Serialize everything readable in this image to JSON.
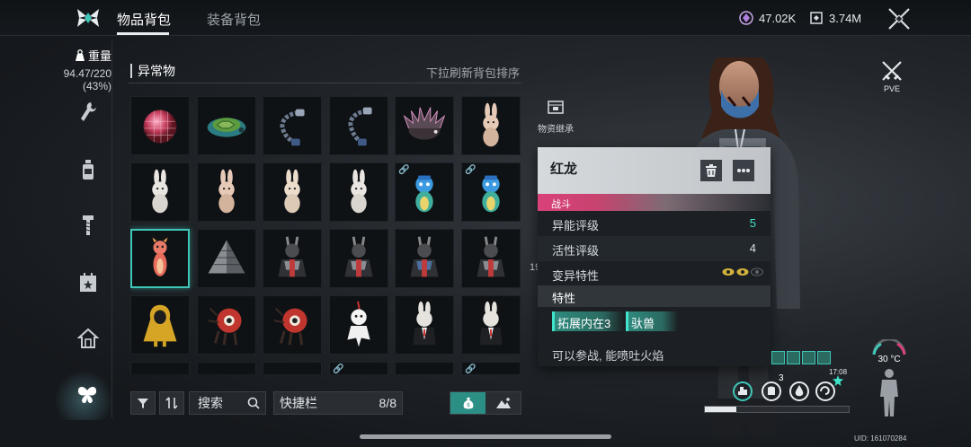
{
  "tabs": [
    {
      "label": "物品背包",
      "active": true
    },
    {
      "label": "装备背包",
      "active": false
    }
  ],
  "currency": [
    {
      "icon": "crystal-icon",
      "value": "47.02K"
    },
    {
      "icon": "supply-icon",
      "value": "3.74M"
    }
  ],
  "weight": {
    "title": "重量",
    "value": "94.47/220",
    "percent": "(43%)"
  },
  "sidebar": [
    "wrench-icon",
    "bottle-icon",
    "bolt-icon",
    "calendar-icon",
    "house-icon",
    "butterfly-icon"
  ],
  "section": {
    "title": "异常物",
    "hint": "下拉刷新背包排序"
  },
  "grid_items": [
    [
      "disco-ball",
      "turtle-shell",
      "chain-bracelet",
      "chain-bracelet",
      "porcupine",
      "bunny-plush"
    ],
    [
      "bunny-plush",
      "bunny-plush",
      "bunny-plush",
      "bunny-plush",
      "dragon-figure-blue",
      "dragon-figure-blue"
    ],
    [
      "red-dragon",
      "pyramid",
      "samurai-rabbit",
      "samurai-rabbit",
      "samurai-rabbit",
      "samurai-rabbit"
    ],
    [
      "yellow-raincoat",
      "eyeball-creature",
      "eyeball-creature",
      "white-doll",
      "suit-rabbit",
      "suit-rabbit"
    ]
  ],
  "search": {
    "label": "搜索"
  },
  "quickbar": {
    "label": "快捷栏",
    "count": "8/8"
  },
  "materials": {
    "label": "物资继承"
  },
  "partial_numbers": [
    "19"
  ],
  "popup": {
    "title": "红龙",
    "tag": "战斗",
    "stats": [
      {
        "label": "异能评级",
        "value": "5"
      },
      {
        "label": "活性评级",
        "value": "4"
      },
      {
        "label": "变异特性",
        "value": ""
      }
    ],
    "traits_title": "特性",
    "traits": [
      "拓展内在3",
      "驮兽"
    ],
    "description": "可以参战, 能喷吐火焰"
  },
  "pve_label": "PVE",
  "temperature": "30 °C",
  "clock": "17:08",
  "status_count": "3",
  "health_fraction": 0.22,
  "uid": "UID: 161070284",
  "colors": {
    "accent": "#3ec7b8",
    "combat_tag": "#d9417a"
  }
}
